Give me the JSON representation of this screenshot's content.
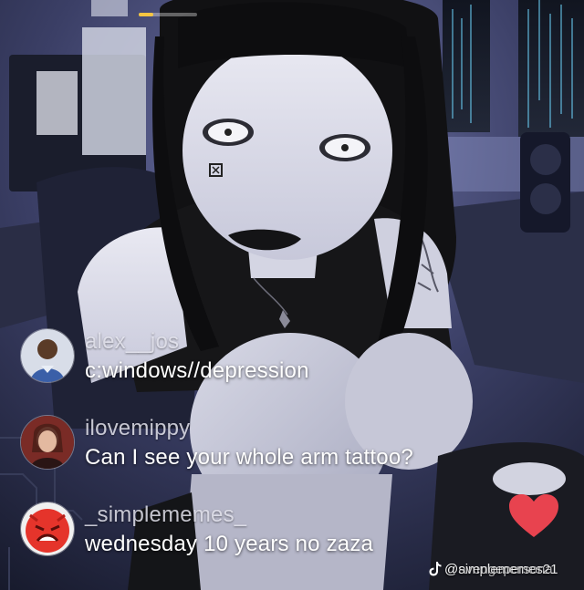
{
  "stream": {
    "progress_fraction": 0.25
  },
  "comments": [
    {
      "username": "alex__jos",
      "text": "c:windows//depression"
    },
    {
      "username": "ilovemippy",
      "text": "Can I see your whole arm tattoo?"
    },
    {
      "username": "_simplememes_",
      "text": "wednesday 10 years no zaza"
    }
  ],
  "watermark": {
    "handle_a": "@simplememes21",
    "handle_b": "@avengepersona"
  },
  "icons": {
    "heart": "heart-icon",
    "tiktok": "tiktok-logo-icon"
  },
  "colors": {
    "heart": "#e8434f",
    "progress": "#f5c542"
  }
}
